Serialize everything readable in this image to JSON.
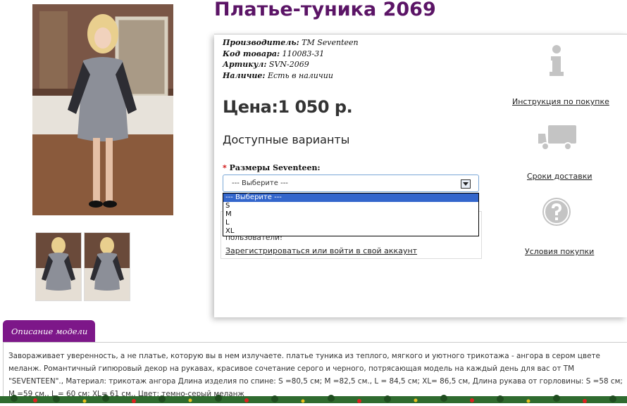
{
  "product": {
    "title": "Платье-туника 2069",
    "specs": [
      {
        "label": "Производитель:",
        "value": " ТМ Seventeen"
      },
      {
        "label": "Код товара:",
        "value": " 110083-31"
      },
      {
        "label": "Артикул:",
        "value": " SVN-2069"
      },
      {
        "label": "Наличие:",
        "value": " Есть в наличии"
      }
    ],
    "price": "Цена:1 050 р.",
    "variants_heading": "Доступные варианты",
    "size_required_mark": "*",
    "size_label": " Размеры Seventeen:",
    "size_select": {
      "selected": "--- Выберите ---",
      "options": [
        "--- Выберите ---",
        "S",
        "M",
        "L",
        "XL"
      ]
    },
    "login_notice": "пользователи!",
    "login_link": "Зарегистрироваться или войти в свой аккаунт"
  },
  "side_links": {
    "instructions": "Инструкция по покупке",
    "delivery": "Сроки доставки",
    "terms": "Условия покупки"
  },
  "icons": {
    "info": "info-icon",
    "truck": "truck-icon",
    "help": "question-icon"
  },
  "description": {
    "tab_label": "Описание модели",
    "text": "Завораживает уверенность, а не платье, которую вы в нем излучаете. платье туника из теплого, мягкого и уютного трикотажа - ангора в сером цвете меланж. Романтичный гипюровый декор на рукавах, красивое сочетание серого и черного, потрясающая модель на каждый день для вас от ТМ \"SEVENTEEN\"., Материал: трикотаж ангора Длина изделия по спине: S =80,5 см; M =82,5 см., L = 84,5 см; XL= 86,5 см, Длина рукава от горловины: S =58 см; M =59 см., L = 60 см; XL= 61 см., Цвет: темно-серый меланж"
  },
  "colors": {
    "title": "#5b1466",
    "tab": "#7d1789",
    "select_border": "#7aa7d6",
    "option_highlight": "#3366cc"
  }
}
